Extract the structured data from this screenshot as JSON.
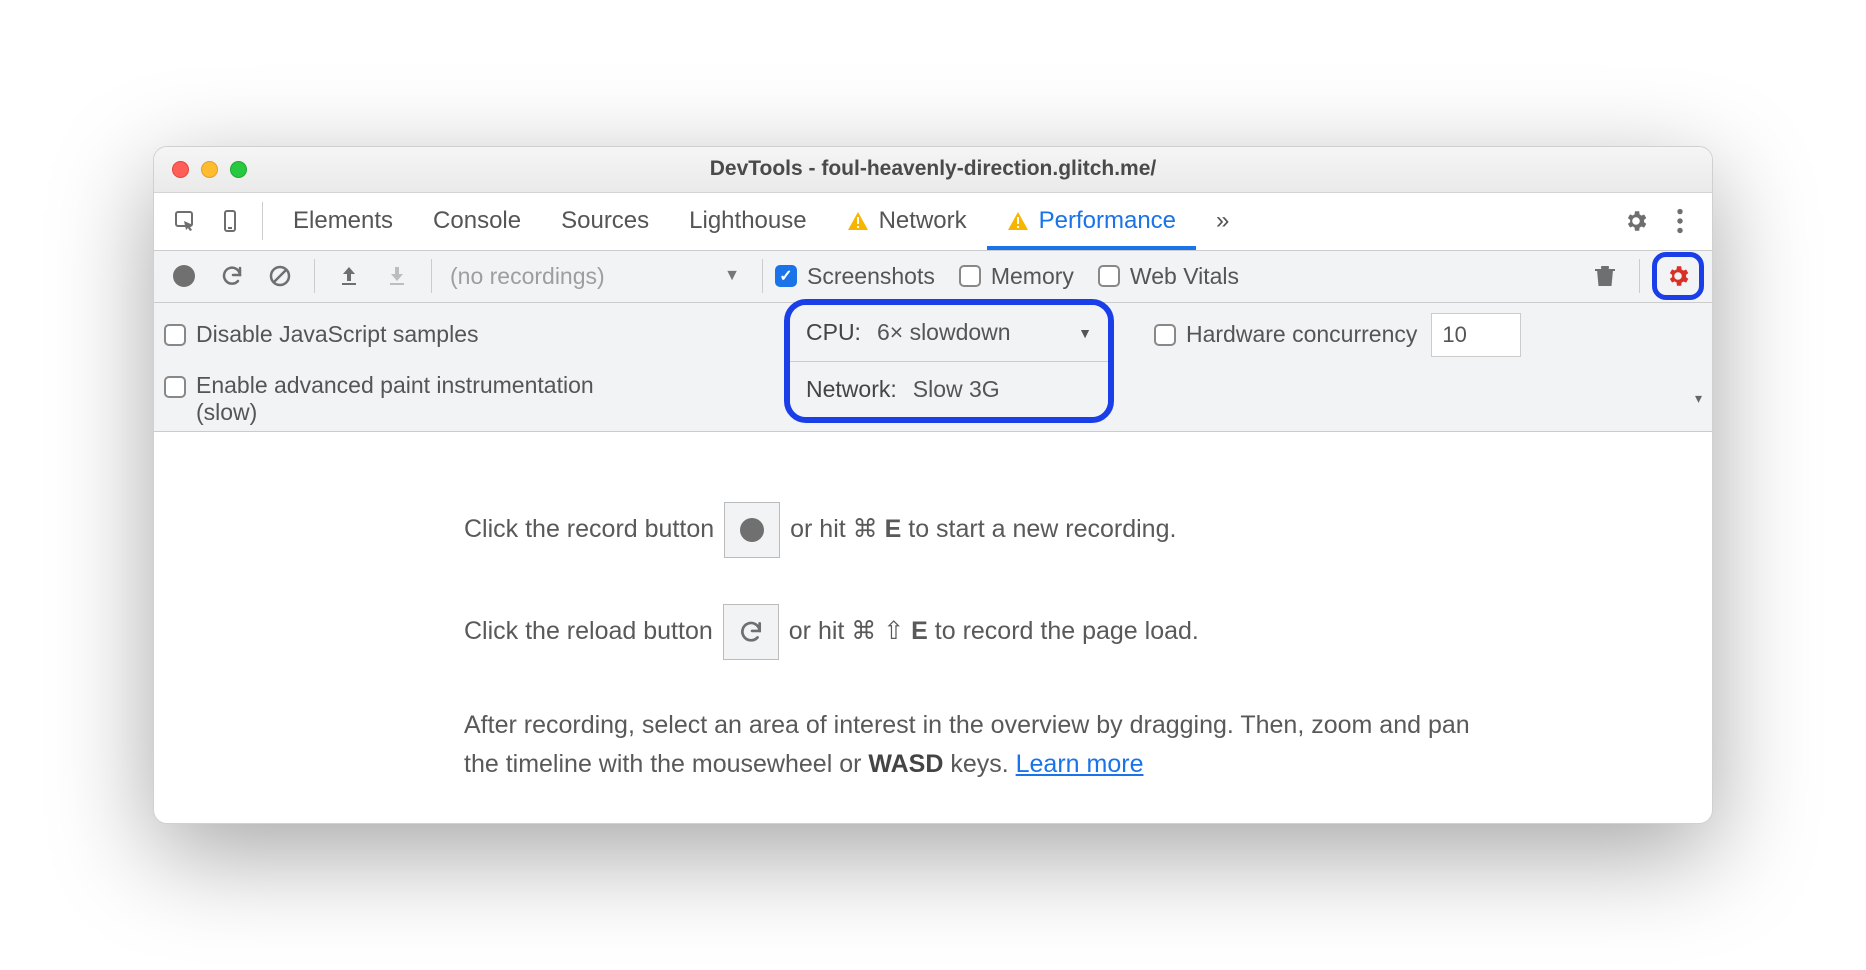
{
  "window": {
    "title": "DevTools - foul-heavenly-direction.glitch.me/"
  },
  "tabs": {
    "items": [
      "Elements",
      "Console",
      "Sources",
      "Lighthouse",
      "Network",
      "Performance"
    ],
    "active": "Performance",
    "more": "»"
  },
  "toolbar": {
    "no_recordings": "(no recordings)",
    "screenshots_label": "Screenshots",
    "memory_label": "Memory",
    "webvitals_label": "Web Vitals",
    "screenshots_checked": true,
    "memory_checked": false,
    "webvitals_checked": false
  },
  "settings": {
    "disable_js_label": "Disable JavaScript samples",
    "paint_label": "Enable advanced paint instrumentation (slow)",
    "cpu_label": "CPU:",
    "cpu_value": "6× slowdown",
    "net_label": "Network:",
    "net_value": "Slow 3G",
    "hw_label": "Hardware concurrency",
    "hw_value": "10"
  },
  "help": {
    "line1a": "Click the record button",
    "line1b": "or hit ⌘ ",
    "line1key": "E",
    "line1c": " to start a new recording.",
    "line2a": "Click the reload button",
    "line2b": "or hit ⌘ ⇧ ",
    "line2key": "E",
    "line2c": " to record the page load.",
    "para_a": "After recording, select an area of interest in the overview by dragging. Then, zoom and pan the timeline with the mousewheel or ",
    "para_b": "WASD",
    "para_c": " keys. ",
    "learn": "Learn more"
  }
}
